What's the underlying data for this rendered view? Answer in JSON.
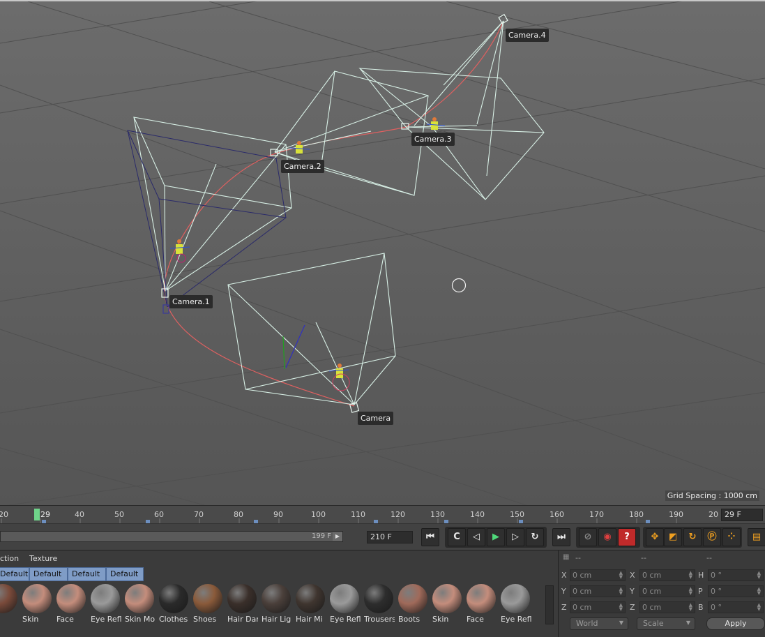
{
  "viewport": {
    "camera_labels": [
      "Camera.4",
      "Camera.3",
      "Camera.2",
      "Camera.1",
      "Camera"
    ],
    "grid_spacing": "Grid Spacing : 1000 cm"
  },
  "timeline": {
    "ticks": [
      "20",
      "29",
      "40",
      "50",
      "60",
      "70",
      "80",
      "90",
      "100",
      "110",
      "120",
      "130",
      "140",
      "150",
      "160",
      "170",
      "180",
      "190",
      "20"
    ],
    "current_frame": "29 F"
  },
  "transport": {
    "range_end": "199 F",
    "max_frame": "210 F",
    "buttons": {
      "goto_start": "⏮",
      "prev_key": "C",
      "step_back": "◁",
      "play": "▶",
      "step_fwd": "▷",
      "next_key": "↻",
      "goto_end": "⏭"
    }
  },
  "materials": {
    "menu": [
      "ction",
      "Texture"
    ],
    "layers": [
      "Default",
      "Default",
      "Default",
      "Default"
    ],
    "swatches": [
      {
        "name": "s",
        "color": "#7a4a3a"
      },
      {
        "name": "Skin",
        "color": "#c48d7c"
      },
      {
        "name": "Face",
        "color": "#c48d7c"
      },
      {
        "name": "Eye Refl",
        "color": "#9a9a9a"
      },
      {
        "name": "Skin Mo",
        "color": "#c48d7c"
      },
      {
        "name": "Clothes",
        "color": "#2a2a2a"
      },
      {
        "name": "Shoes",
        "color": "#8a5a3a"
      },
      {
        "name": "Hair Dar",
        "color": "#3a2f2a"
      },
      {
        "name": "Hair Lig",
        "color": "#4a3f3a"
      },
      {
        "name": "Hair Mi",
        "color": "#3f352f"
      },
      {
        "name": "Eye Refl",
        "color": "#9a9a9a"
      },
      {
        "name": "Trousers",
        "color": "#2d2d2d"
      },
      {
        "name": "Boots",
        "color": "#a06a5a"
      },
      {
        "name": "Skin",
        "color": "#c48d7c"
      },
      {
        "name": "Face",
        "color": "#c48d7c"
      },
      {
        "name": "Eye Refl",
        "color": "#9a9a9a"
      }
    ]
  },
  "coordinates": {
    "headers": [
      "--",
      "--",
      "--"
    ],
    "rows": [
      {
        "a1": "X",
        "v1": "0 cm",
        "a2": "X",
        "v2": "0 cm",
        "a3": "H",
        "v3": "0 °"
      },
      {
        "a1": "Y",
        "v1": "0 cm",
        "a2": "Y",
        "v2": "0 cm",
        "a3": "P",
        "v3": "0 °"
      },
      {
        "a1": "Z",
        "v1": "0 cm",
        "a2": "Z",
        "v2": "0 cm",
        "a3": "B",
        "v3": "0 °"
      }
    ],
    "space": "World",
    "mode": "Scale",
    "apply": "Apply"
  },
  "colors": {
    "wireframe": "#d8f0e6",
    "path": "#e06060",
    "accent": "#6fd48a"
  }
}
